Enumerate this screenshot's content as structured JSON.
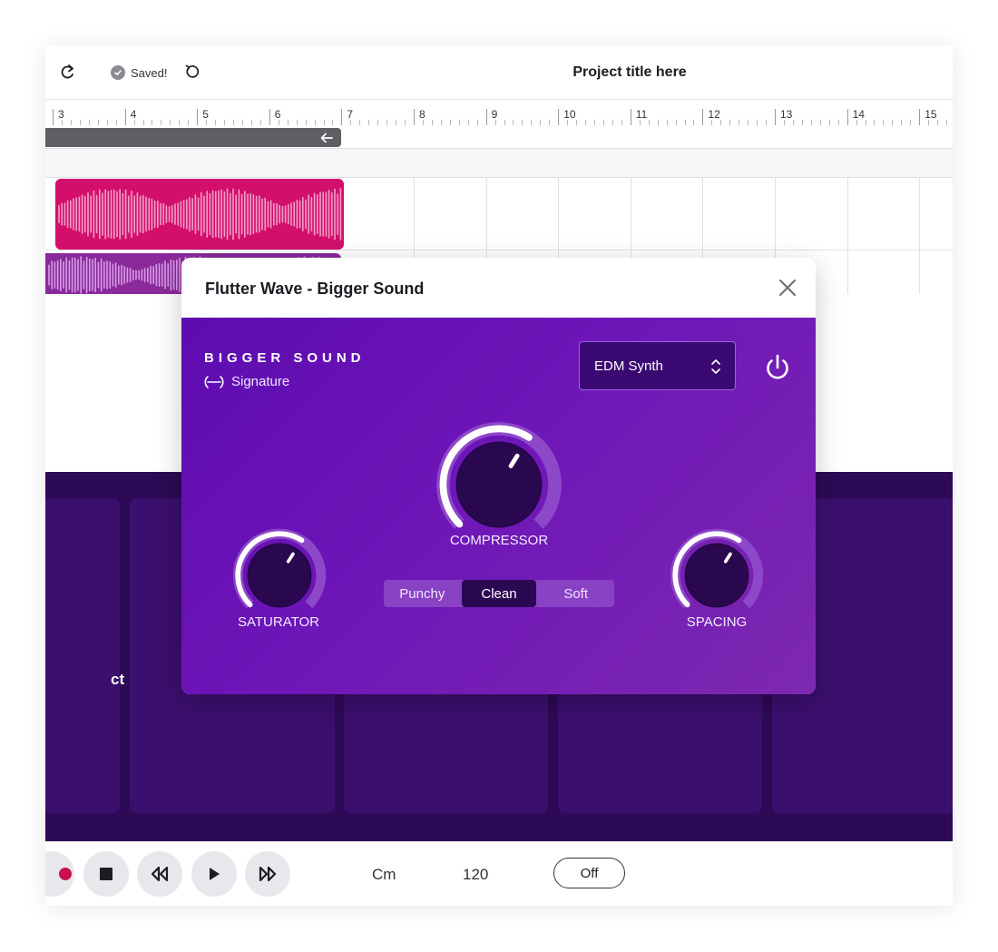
{
  "header": {
    "saved_label": "Saved!",
    "project_title": "Project title here"
  },
  "ruler": {
    "numbers": [
      "3",
      "4",
      "5",
      "6",
      "7",
      "8",
      "9",
      "10",
      "11",
      "12",
      "13",
      "14",
      "15"
    ]
  },
  "pads": {
    "partial_label": "ct"
  },
  "transport": {
    "key": "Cm",
    "bpm": "120",
    "metronome": "Off"
  },
  "modal": {
    "title": "Flutter Wave - Bigger Sound",
    "fx_name": "BIGGER SOUND",
    "signature_label": "Signature",
    "preset": "EDM Synth",
    "knobs": {
      "compressor": {
        "label": "COMPRESSOR",
        "value": 0.62
      },
      "saturator": {
        "label": "SATURATOR",
        "value": 0.62
      },
      "spacing": {
        "label": "SPACING",
        "value": 0.62
      }
    },
    "modes": [
      "Punchy",
      "Clean",
      "Soft"
    ],
    "active_mode": "Clean"
  },
  "colors": {
    "clip_pink": "#d2106c",
    "clip_purple": "#8a2a9a",
    "pad_bg": "#2d0a55",
    "modal_gradient_start": "#5d0cb0",
    "modal_gradient_end": "#7d28b0",
    "record": "#c8104f"
  }
}
